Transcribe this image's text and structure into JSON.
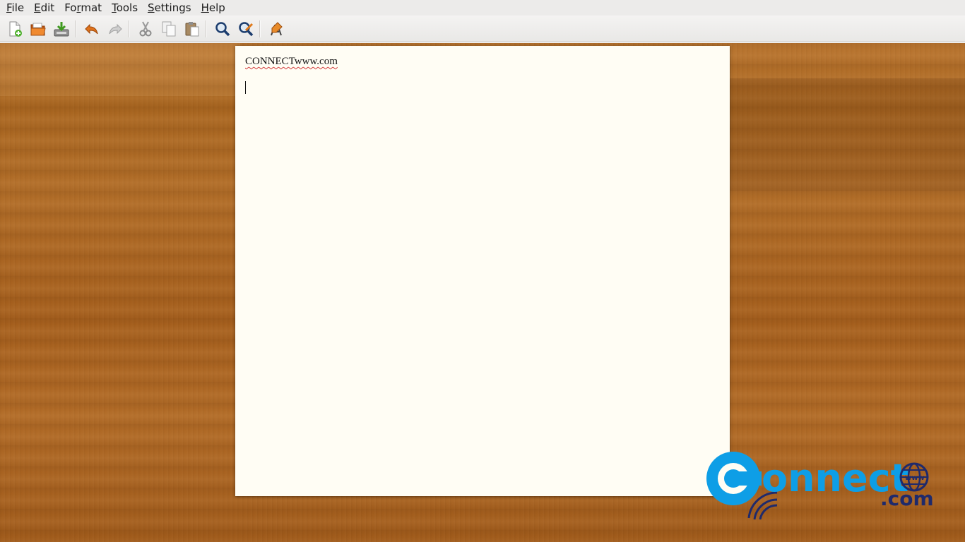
{
  "menubar": {
    "items": [
      {
        "mnemonic": "F",
        "rest": "ile"
      },
      {
        "mnemonic": "E",
        "rest": "dit"
      },
      {
        "mnemonic": "",
        "pre": "Fo",
        "mid": "r",
        "post": "mat"
      },
      {
        "mnemonic": "T",
        "rest": "ools"
      },
      {
        "mnemonic": "S",
        "rest": "ettings"
      },
      {
        "mnemonic": "H",
        "rest": "elp"
      }
    ]
  },
  "toolbar": {
    "buttons": [
      {
        "icon": "new-document-icon"
      },
      {
        "icon": "open-folder-icon"
      },
      {
        "icon": "save-icon"
      },
      {
        "icon": "undo-icon"
      },
      {
        "icon": "redo-icon"
      },
      {
        "icon": "cut-icon"
      },
      {
        "icon": "copy-icon"
      },
      {
        "icon": "paste-icon"
      },
      {
        "icon": "find-icon"
      },
      {
        "icon": "find-replace-icon"
      },
      {
        "icon": "spellcheck-icon"
      }
    ]
  },
  "document": {
    "text": "CONNECTwww.com"
  },
  "watermark": {
    "brand": "onnect",
    "domain": ".com",
    "globe_text": "www"
  },
  "colors": {
    "accent_blue": "#0e9ee6",
    "logo_dark": "#1f2a6b",
    "paper": "#fffdf4"
  }
}
